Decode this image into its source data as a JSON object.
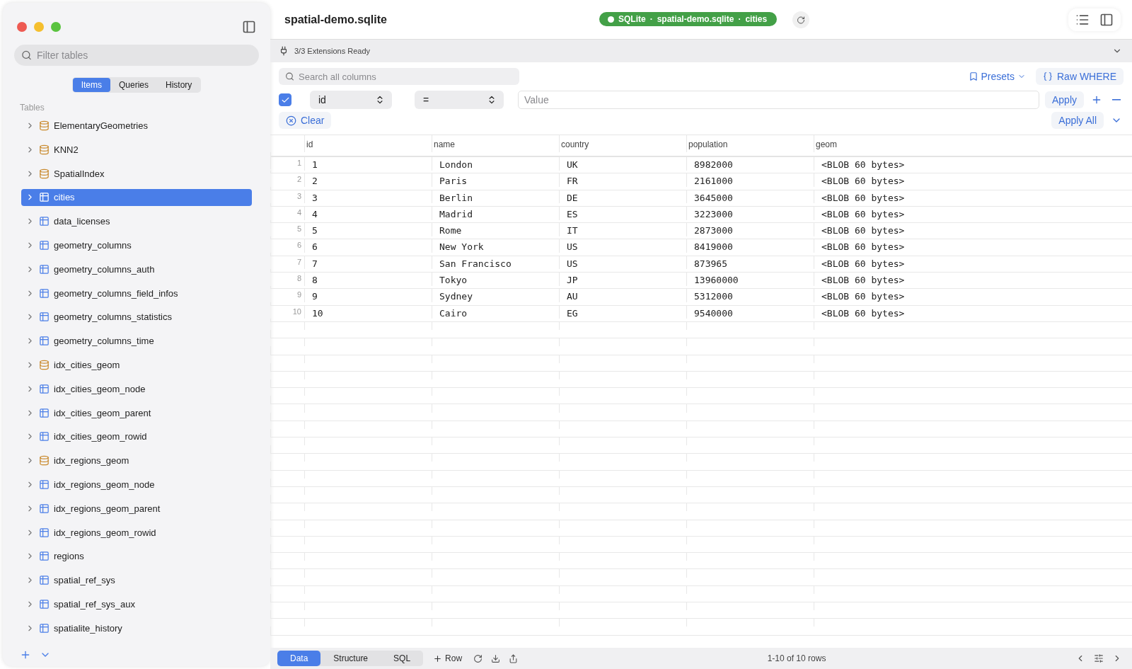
{
  "sidebar": {
    "filter": {
      "placeholder": "Filter tables"
    },
    "tabs": [
      {
        "label": "Items",
        "selected": true
      },
      {
        "label": "Queries",
        "selected": false
      },
      {
        "label": "History",
        "selected": false
      }
    ],
    "section": "Tables",
    "items": [
      {
        "label": "ElementaryGeometries",
        "kind": "view",
        "selected": false
      },
      {
        "label": "KNN2",
        "kind": "view",
        "selected": false
      },
      {
        "label": "SpatialIndex",
        "kind": "view",
        "selected": false
      },
      {
        "label": "cities",
        "kind": "table",
        "selected": true
      },
      {
        "label": "data_licenses",
        "kind": "table",
        "selected": false
      },
      {
        "label": "geometry_columns",
        "kind": "table",
        "selected": false
      },
      {
        "label": "geometry_columns_auth",
        "kind": "table",
        "selected": false
      },
      {
        "label": "geometry_columns_field_infos",
        "kind": "table",
        "selected": false
      },
      {
        "label": "geometry_columns_statistics",
        "kind": "table",
        "selected": false
      },
      {
        "label": "geometry_columns_time",
        "kind": "table",
        "selected": false
      },
      {
        "label": "idx_cities_geom",
        "kind": "view",
        "selected": false
      },
      {
        "label": "idx_cities_geom_node",
        "kind": "table",
        "selected": false
      },
      {
        "label": "idx_cities_geom_parent",
        "kind": "table",
        "selected": false
      },
      {
        "label": "idx_cities_geom_rowid",
        "kind": "table",
        "selected": false
      },
      {
        "label": "idx_regions_geom",
        "kind": "view",
        "selected": false
      },
      {
        "label": "idx_regions_geom_node",
        "kind": "table",
        "selected": false
      },
      {
        "label": "idx_regions_geom_parent",
        "kind": "table",
        "selected": false
      },
      {
        "label": "idx_regions_geom_rowid",
        "kind": "table",
        "selected": false
      },
      {
        "label": "regions",
        "kind": "table",
        "selected": false
      },
      {
        "label": "spatial_ref_sys",
        "kind": "table",
        "selected": false
      },
      {
        "label": "spatial_ref_sys_aux",
        "kind": "table",
        "selected": false
      },
      {
        "label": "spatialite_history",
        "kind": "table",
        "selected": false
      }
    ]
  },
  "window": {
    "title": "spatial-demo.sqlite",
    "connection": [
      "SQLite",
      "·",
      "spatial-demo.sqlite",
      "·",
      "cities"
    ]
  },
  "extensions": "3/3 Extensions Ready",
  "search": {
    "placeholder": "Search all columns"
  },
  "presets": "Presets",
  "raw_where": "Raw WHERE",
  "filter": {
    "enabled": true,
    "column": "id",
    "operator": "=",
    "placeholder": "Value",
    "apply": "Apply"
  },
  "clear": "Clear",
  "apply_all": "Apply All",
  "table": {
    "columns": [
      "id",
      "name",
      "country",
      "population",
      "geom"
    ],
    "rows": [
      [
        "1",
        "London",
        "UK",
        "8982000",
        "<BLOB 60 bytes>"
      ],
      [
        "2",
        "Paris",
        "FR",
        "2161000",
        "<BLOB 60 bytes>"
      ],
      [
        "3",
        "Berlin",
        "DE",
        "3645000",
        "<BLOB 60 bytes>"
      ],
      [
        "4",
        "Madrid",
        "ES",
        "3223000",
        "<BLOB 60 bytes>"
      ],
      [
        "5",
        "Rome",
        "IT",
        "2873000",
        "<BLOB 60 bytes>"
      ],
      [
        "6",
        "New York",
        "US",
        "8419000",
        "<BLOB 60 bytes>"
      ],
      [
        "7",
        "San Francisco",
        "US",
        "873965",
        "<BLOB 60 bytes>"
      ],
      [
        "8",
        "Tokyo",
        "JP",
        "13960000",
        "<BLOB 60 bytes>"
      ],
      [
        "9",
        "Sydney",
        "AU",
        "5312000",
        "<BLOB 60 bytes>"
      ],
      [
        "10",
        "Cairo",
        "EG",
        "9540000",
        "<BLOB 60 bytes>"
      ]
    ],
    "row_numbers": [
      "1",
      "2",
      "3",
      "4",
      "5",
      "6",
      "7",
      "8",
      "9",
      "10"
    ]
  },
  "bottom_tabs": [
    {
      "label": "Data",
      "selected": true
    },
    {
      "label": "Structure",
      "selected": false
    },
    {
      "label": "SQL",
      "selected": false
    }
  ],
  "add_row": "Row",
  "status": "1-10 of 10 rows"
}
